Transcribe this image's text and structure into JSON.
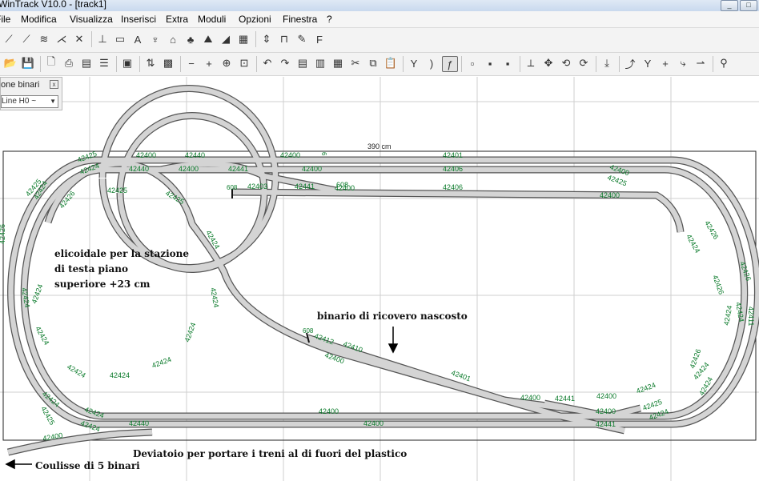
{
  "window": {
    "title": "WinTrack  V10.0 - [track1]",
    "buttons": [
      "_",
      "□"
    ]
  },
  "menu": [
    "File",
    "Modifica",
    "Visualizza",
    "Inserisci",
    "Extra",
    "Moduli",
    "Opzioni",
    "Finestra",
    "?"
  ],
  "toolbar1": [
    {
      "icon": "flex-track-icon",
      "glyph": "⟋"
    },
    {
      "icon": "flex-track-2-icon",
      "glyph": "⟋"
    },
    {
      "icon": "track-tool-icon",
      "glyph": "≋"
    },
    {
      "icon": "turnout-icon",
      "glyph": "⋌"
    },
    {
      "icon": "crossing-icon",
      "glyph": "✕"
    },
    {
      "icon": "sep"
    },
    {
      "icon": "bumper-icon",
      "glyph": "⊥"
    },
    {
      "icon": "platform-icon",
      "glyph": "▭"
    },
    {
      "icon": "text-icon",
      "glyph": "A"
    },
    {
      "icon": "signal-icon",
      "glyph": "♆"
    },
    {
      "icon": "building-icon",
      "glyph": "⌂"
    },
    {
      "icon": "tree-icon",
      "glyph": "♣"
    },
    {
      "icon": "landscape-icon",
      "glyph": "⛰"
    },
    {
      "icon": "slope-icon",
      "glyph": "◢"
    },
    {
      "icon": "chart-icon",
      "glyph": "▦"
    },
    {
      "icon": "sep"
    },
    {
      "icon": "height-icon",
      "glyph": "⇕"
    },
    {
      "icon": "bridge-icon",
      "glyph": "⊓"
    },
    {
      "icon": "pen-icon",
      "glyph": "✎"
    },
    {
      "icon": "flag-icon",
      "glyph": "F"
    }
  ],
  "toolbar2": [
    {
      "icon": "open-icon",
      "glyph": "📂"
    },
    {
      "icon": "save-icon",
      "glyph": "💾"
    },
    {
      "icon": "sep"
    },
    {
      "icon": "preview-icon",
      "glyph": "🗋"
    },
    {
      "icon": "print-icon",
      "glyph": "⎙"
    },
    {
      "icon": "print-setup-icon",
      "glyph": "▤"
    },
    {
      "icon": "list-icon",
      "glyph": "☰"
    },
    {
      "icon": "sep"
    },
    {
      "icon": "parts-icon",
      "glyph": "▣"
    },
    {
      "icon": "sep"
    },
    {
      "icon": "height-profile-icon",
      "glyph": "⇅"
    },
    {
      "icon": "picture-icon",
      "glyph": "▩"
    },
    {
      "icon": "sep"
    },
    {
      "icon": "zoom-out-icon",
      "glyph": "−"
    },
    {
      "icon": "zoom-in-icon",
      "glyph": "+"
    },
    {
      "icon": "zoom-window-icon",
      "glyph": "⊕"
    },
    {
      "icon": "zoom-all-icon",
      "glyph": "⊡"
    },
    {
      "icon": "sep"
    },
    {
      "icon": "undo-icon",
      "glyph": "↶"
    },
    {
      "icon": "redo-icon",
      "glyph": "↷"
    },
    {
      "icon": "properties-icon",
      "glyph": "▤"
    },
    {
      "icon": "list-view-icon",
      "glyph": "▥"
    },
    {
      "icon": "layer-icon",
      "glyph": "▦"
    },
    {
      "icon": "cut-icon",
      "glyph": "✂"
    },
    {
      "icon": "copy-icon",
      "glyph": "⧉"
    },
    {
      "icon": "paste-icon",
      "glyph": "📋"
    },
    {
      "icon": "sep"
    },
    {
      "icon": "split-icon",
      "glyph": "Y"
    },
    {
      "icon": "curve-icon",
      "glyph": ")"
    },
    {
      "icon": "flex-icon",
      "glyph": "ƒ",
      "active": true
    },
    {
      "icon": "sep"
    },
    {
      "icon": "group-icon",
      "glyph": "▫"
    },
    {
      "icon": "align-icon",
      "glyph": "▪"
    },
    {
      "icon": "merge-icon",
      "glyph": "▪"
    },
    {
      "icon": "sep"
    },
    {
      "icon": "measure-icon",
      "glyph": "⟂"
    },
    {
      "icon": "move-icon",
      "glyph": "✥"
    },
    {
      "icon": "rotate-icon",
      "glyph": "⟲"
    },
    {
      "icon": "rotate180-icon",
      "glyph": "⟳"
    },
    {
      "icon": "sep"
    },
    {
      "icon": "connect-icon",
      "glyph": "⤓"
    },
    {
      "icon": "sep"
    },
    {
      "icon": "tool-a-icon",
      "glyph": "⤴"
    },
    {
      "icon": "tool-b-icon",
      "glyph": "Y"
    },
    {
      "icon": "tool-c-icon",
      "glyph": "+"
    },
    {
      "icon": "tool-d-icon",
      "glyph": "⤷"
    },
    {
      "icon": "tool-e-icon",
      "glyph": "⇀"
    },
    {
      "icon": "sep"
    },
    {
      "icon": "search-icon",
      "glyph": "⚲"
    }
  ],
  "panel": {
    "title": "one binari",
    "select_value": "Line H0 ~"
  },
  "drawing": {
    "dimension_label": "390 cm",
    "annotations": {
      "helix": [
        "elicoidale per la stazione",
        "di testa piano",
        "superiore +23 cm"
      ],
      "hidden_siding": "binario di ricovero nascosto",
      "turnout_note": "Deviatoio per portare i treni al di fuori del plastico",
      "coulisse": "Coulisse di 5 binari"
    },
    "small_marks": [
      "6",
      "608",
      "608"
    ],
    "track_labels": [
      "42425",
      "42400",
      "42440",
      "42400",
      "42401",
      "42424",
      "42440",
      "42400",
      "42441",
      "42400",
      "42406",
      "42400",
      "42425",
      "42424",
      "42426",
      "42425",
      "608",
      "42403",
      "42441",
      "42400",
      "42406",
      "42400",
      "42425",
      "42425",
      "42426",
      "42424",
      "42426",
      "42426",
      "42424",
      "42424",
      "42426",
      "42411",
      "42424",
      "42424",
      "42424",
      "42424",
      "42424",
      "42424",
      "42424",
      "42426",
      "42424",
      "42412",
      "42410",
      "42400",
      "42401",
      "42441",
      "42400",
      "42424",
      "42400",
      "42425",
      "42441",
      "42424",
      "42425",
      "42424",
      "42400",
      "42400",
      "42440",
      "42400",
      "42424",
      "42424",
      "42400",
      "42424",
      "42424",
      "42424"
    ]
  }
}
